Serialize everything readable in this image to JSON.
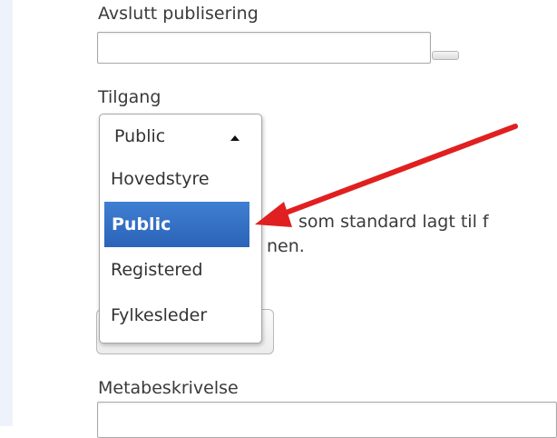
{
  "fields": {
    "end_publishing_label": "Avslutt publisering",
    "access_label": "Tilgang",
    "meta_description_label": "Metabeskrivelse"
  },
  "access_select": {
    "selected": "Public",
    "options": [
      "Hovedstyre",
      "Public",
      "Registered",
      "Fylkesleder"
    ],
    "highlighted": "Public"
  },
  "help_text": {
    "line1": "som standard lagt til f",
    "line2": "nen."
  },
  "colors": {
    "arrow": "#e02020",
    "highlight": "#2e6cc0"
  }
}
